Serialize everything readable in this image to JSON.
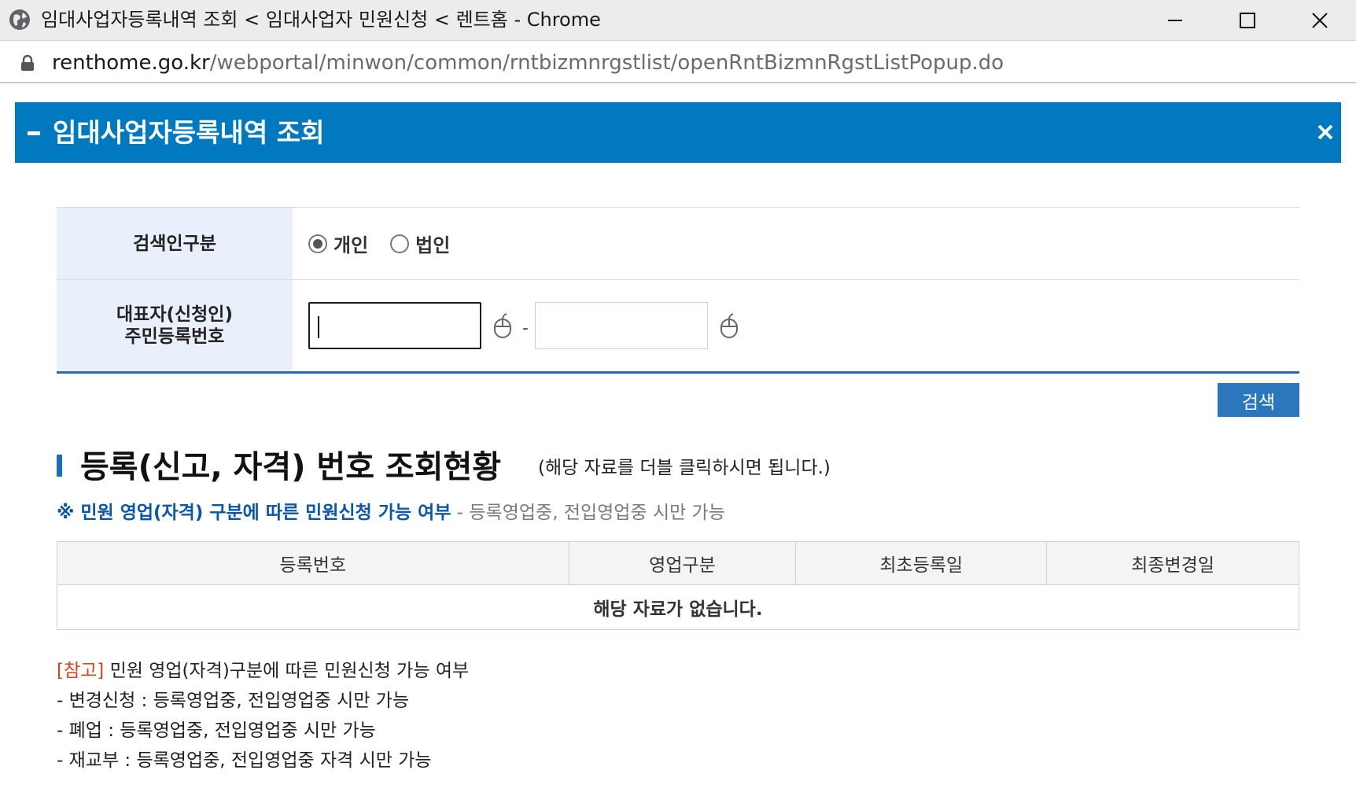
{
  "window": {
    "title": "임대사업자등록내역 조회 < 임대사업자 민원신청 < 렌트홈 - Chrome",
    "url_host": "renthome.go.kr",
    "url_path": "/webportal/minwon/common/rntbizmnrgstlist/openRntBizmnRgstListPopup.do"
  },
  "popup": {
    "title": "임대사업자등록내역 조회",
    "accent_color": "#0079c0"
  },
  "form": {
    "searcher_type_label": "검색인구분",
    "options": [
      {
        "label": "개인",
        "selected": true
      },
      {
        "label": "법인",
        "selected": false
      }
    ],
    "id_label_line1": "대표자(신청인)",
    "id_label_line2": "주민등록번호",
    "id_part1_value": "",
    "id_part2_value": "",
    "separator": "-",
    "search_button": "검색"
  },
  "section": {
    "title": "등록(신고, 자격) 번호 조회현황",
    "subtitle": "(해당 자료를 더블 클릭하시면 됩니다.)",
    "notice_strong": "※ 민원 영업(자격) 구분에 따른 민원신청 가능 여부",
    "notice_rest": " - 등록영업중, 전입영업중 시만 가능"
  },
  "table": {
    "headers": [
      "등록번호",
      "영업구분",
      "최초등록일",
      "최종변경일"
    ],
    "empty_message": "해당 자료가 없습니다."
  },
  "notes": {
    "ref_tag": "[참고]",
    "ref_text": " 민원 영업(자격)구분에 따른 민원신청 가능 여부",
    "lines": [
      "- 변경신청 : 등록영업중, 전입영업중 시만 가능",
      "- 폐업 : 등록영업중, 전입영업중 시만 가능",
      "- 재교부 : 등록영업중, 전입영업중 자격 시만 가능"
    ]
  }
}
